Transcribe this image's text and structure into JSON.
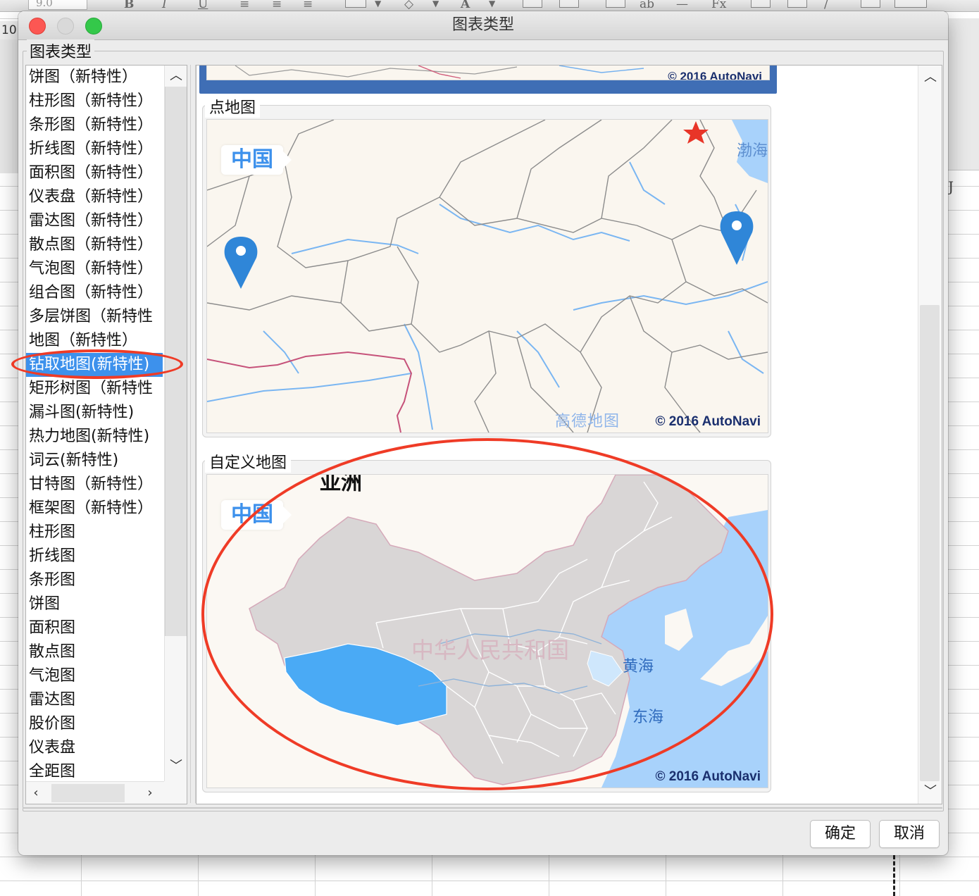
{
  "background_app": {
    "font_size_value": "9.0",
    "row_number": "10",
    "column_letter": "J"
  },
  "dialog": {
    "title": "图表类型",
    "group_label": "图表类型",
    "chart_types": [
      "饼图（新特性）",
      "柱形图（新特性）",
      "条形图（新特性）",
      "折线图（新特性）",
      "面积图（新特性）",
      "仪表盘（新特性）",
      "雷达图（新特性）",
      "散点图（新特性）",
      "气泡图（新特性）",
      "组合图（新特性）",
      "多层饼图（新特性",
      "地图（新特性）",
      "钻取地图(新特性)",
      "矩形树图（新特性",
      "漏斗图(新特性)",
      "热力地图(新特性)",
      "词云(新特性)",
      "甘特图（新特性）",
      "框架图（新特性）",
      "柱形图",
      "折线图",
      "条形图",
      "饼图",
      "面积图",
      "散点图",
      "气泡图",
      "雷达图",
      "股价图",
      "仪表盘",
      "全距图"
    ],
    "selected_index": 12,
    "preview": {
      "top_partial_copyright": "© 2016 AutoNavi",
      "cards": [
        {
          "title": "点地图",
          "badge": "中国",
          "watermark": "高德地图",
          "sea_label": "渤海",
          "copyright": "© 2016 AutoNavi"
        },
        {
          "title": "自定义地图",
          "badge": "中国",
          "continent_label": "亚洲",
          "country_label": "中华人民共和国",
          "sea_labels": [
            "黄海",
            "东海"
          ],
          "copyright": "© 2016 AutoNavi"
        }
      ]
    },
    "buttons": {
      "ok": "确定",
      "cancel": "取消"
    }
  },
  "colors": {
    "selection": "#3d91ec",
    "annotation": "#ef3b26",
    "highlight_region": "#4aaaf5",
    "land": "#d9d6d6",
    "sea": "#a8d2fb"
  }
}
